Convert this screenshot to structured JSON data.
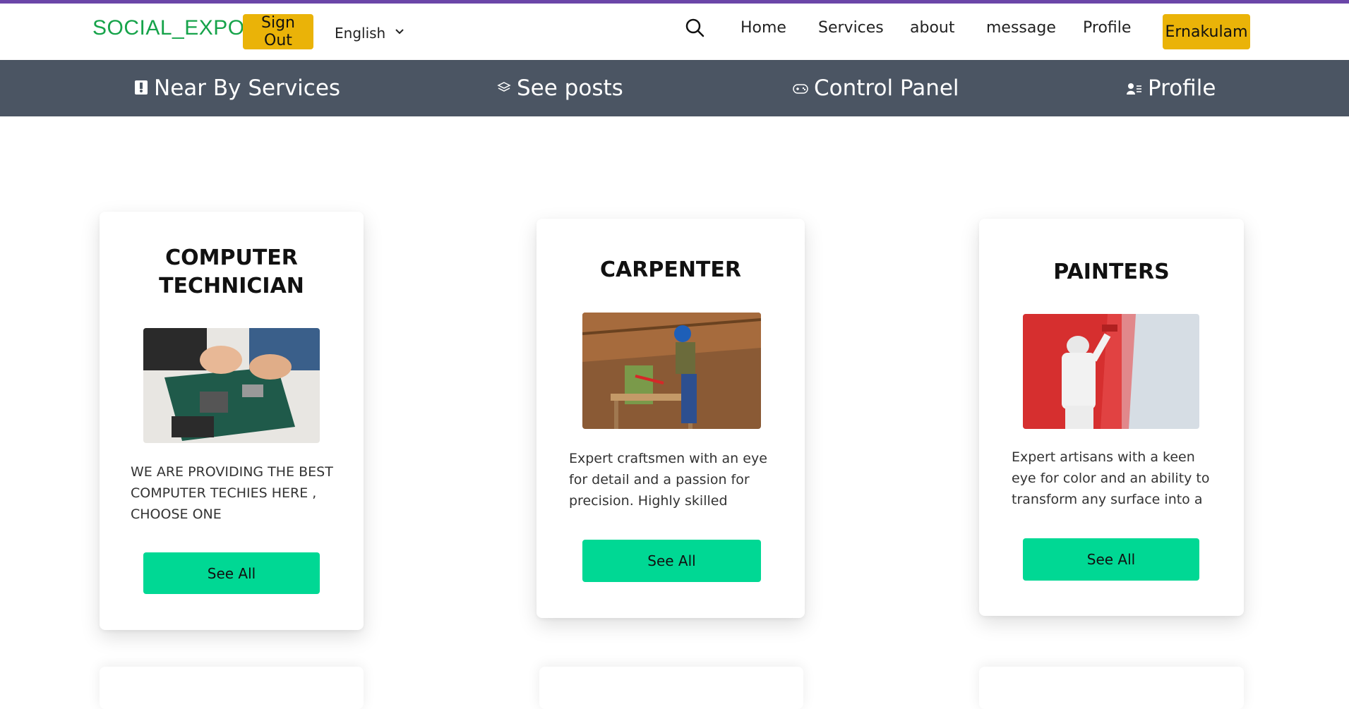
{
  "header": {
    "brand": "SOCIAL_EXPO",
    "sign_out": "Sign Out",
    "language": "English",
    "nav": [
      "Home",
      "Services",
      "about",
      "message",
      "Profile"
    ],
    "location": "Ernakulam"
  },
  "subnav": [
    {
      "label": "Near By Services",
      "icon": "id-badge-icon"
    },
    {
      "label": "See posts",
      "icon": "layers-icon"
    },
    {
      "label": "Control Panel",
      "icon": "gamepad-icon"
    },
    {
      "label": "Profile",
      "icon": "user-list-icon"
    }
  ],
  "cards": [
    {
      "title": "COMPUTER TECHNICIAN",
      "text": "WE ARE PROVIDING THE BEST COMPUTER TECHIES HERE , CHOOSE ONE",
      "button": "See All"
    },
    {
      "title": "CARPENTER",
      "text": "Expert craftsmen with an eye for detail and a passion for precision. Highly skilled artisans",
      "button": "See All"
    },
    {
      "title": "PAINTERS",
      "text": "Expert artisans with a keen eye for color and an ability to transform any surface into a",
      "button": "See All"
    }
  ],
  "colors": {
    "brand": "#16a34a",
    "accent_yellow": "#eab308",
    "subnav_bg": "#4b5563",
    "button_green": "#00d894",
    "top_line": "#6b46a8"
  }
}
